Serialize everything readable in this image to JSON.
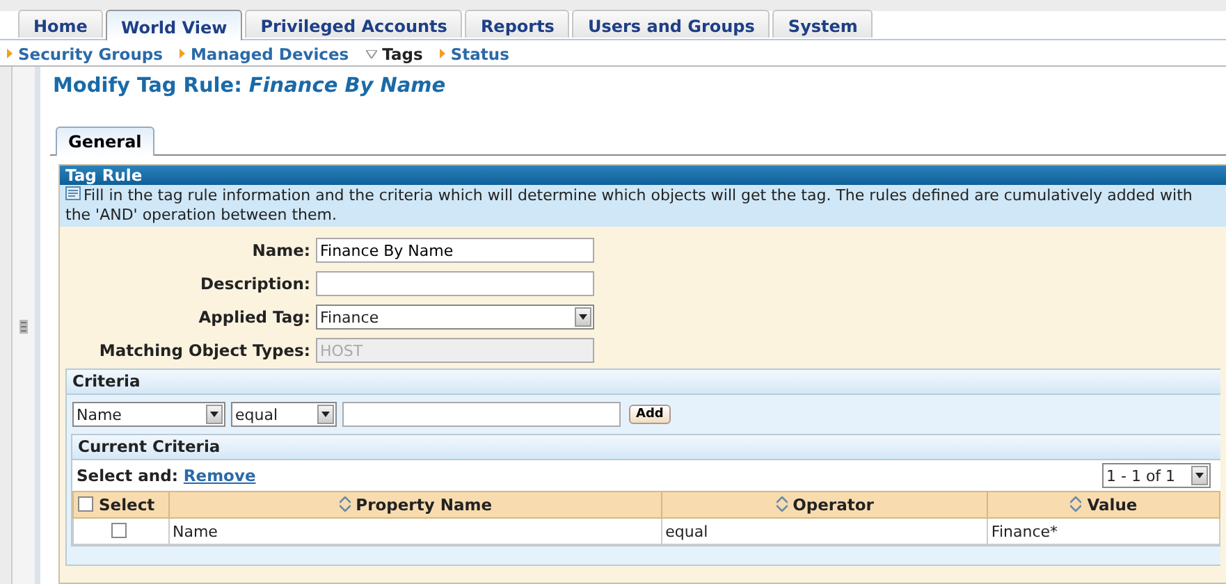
{
  "tabs": [
    {
      "label": "Home",
      "selected": false
    },
    {
      "label": "World View",
      "selected": true
    },
    {
      "label": "Privileged Accounts",
      "selected": false
    },
    {
      "label": "Reports",
      "selected": false
    },
    {
      "label": "Users and Groups",
      "selected": false
    },
    {
      "label": "System",
      "selected": false
    }
  ],
  "subnav": [
    {
      "label": "Security Groups",
      "selected": false
    },
    {
      "label": "Managed Devices",
      "selected": false
    },
    {
      "label": "Tags",
      "selected": true
    },
    {
      "label": "Status",
      "selected": false
    }
  ],
  "page_title": {
    "prefix": "Modify Tag Rule:",
    "name": "Finance By Name"
  },
  "form_tabs": [
    {
      "label": "General"
    }
  ],
  "tag_rule": {
    "title": "Tag Rule",
    "info": "Fill in the tag rule information and the criteria which will determine which objects will get the tag. The rules defined are cumulatively added with the 'AND' operation between them.",
    "fields": [
      {
        "kind": "text",
        "label": "Name:",
        "value": "Finance By Name"
      },
      {
        "kind": "text",
        "label": "Description:"
      },
      {
        "kind": "select",
        "label": "Applied Tag:",
        "value": "Finance"
      },
      {
        "kind": "text",
        "label": "Matching Object Types:",
        "value": "HOST",
        "disabled": true
      }
    ]
  },
  "criteria": {
    "title": "Criteria",
    "property": "Name",
    "operator": "equal",
    "add_button": "Add",
    "current": {
      "title": "Current Criteria",
      "select_and": "Select and:",
      "remove_link": "Remove",
      "pager": "1 - 1 of 1",
      "columns": [
        {
          "label": "Select",
          "kind": "checkbox"
        },
        {
          "label": "Property Name",
          "kind": "sort"
        },
        {
          "label": "Operator",
          "kind": "sort"
        },
        {
          "label": "Value",
          "kind": "sort"
        }
      ],
      "select_all_checked": false,
      "rows": [
        {
          "checked": false,
          "cells": [
            "",
            "Name",
            "equal",
            "Finance*"
          ]
        }
      ]
    }
  }
}
